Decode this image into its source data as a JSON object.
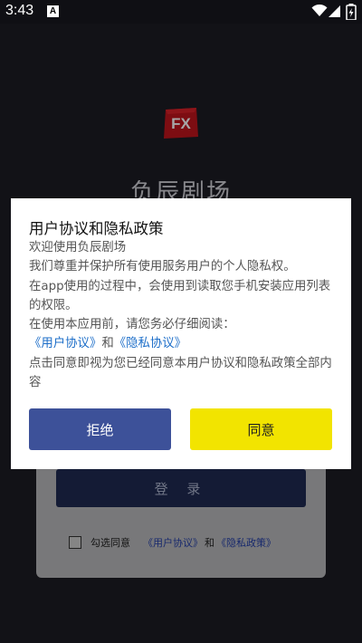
{
  "status_bar": {
    "time": "3:43",
    "notification_icon": "A"
  },
  "app": {
    "logo_text": "FX",
    "title": "负辰剧场",
    "login_button": "登 录",
    "agree": {
      "prefix": "勾选同意",
      "user_agreement": "《用户协议》",
      "and": "和",
      "privacy_policy": "《隐私政策》"
    }
  },
  "dialog": {
    "title": "用户协议和隐私政策",
    "lines": [
      "欢迎使用负辰剧场",
      "我们尊重并保护所有使用服务用户的个人隐私权。",
      "在app使用的过程中，会使用到读取您手机安装应用列表的权限。",
      "在使用本应用前，请您务必仔细阅读："
    ],
    "link_user": "《用户协议》",
    "link_and": "和",
    "link_privacy": "《隐私协议》",
    "closing": "点击同意即视为您已经同意本用户协议和隐私政策全部内容",
    "reject_label": "拒绝",
    "agree_label": "同意"
  },
  "colors": {
    "reject_button": "#3d5199",
    "agree_button": "#f2e400",
    "link": "#1e6fc9"
  }
}
